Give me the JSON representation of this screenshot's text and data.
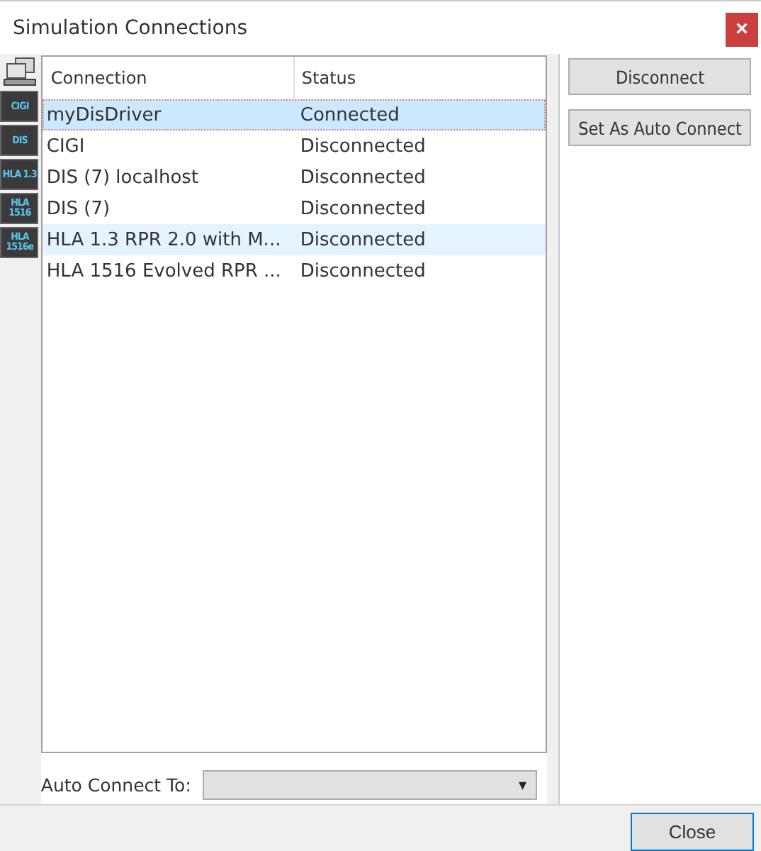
{
  "window": {
    "title": "Simulation Connections",
    "close": "×"
  },
  "toolbar": [
    {
      "kind": "network"
    },
    {
      "kind": "tile",
      "label": "CIGI"
    },
    {
      "kind": "tile",
      "label": "DIS"
    },
    {
      "kind": "tile",
      "label": "HLA 1.3"
    },
    {
      "kind": "tile",
      "label": "HLA 1516"
    },
    {
      "kind": "tile",
      "label": "HLA 1516e"
    }
  ],
  "table": {
    "columns": [
      "Connection",
      "Status"
    ],
    "rows": [
      {
        "connection": "myDisDriver",
        "status": "Connected",
        "selected": true,
        "hovered": false
      },
      {
        "connection": "CIGI",
        "status": "Disconnected",
        "selected": false,
        "hovered": false
      },
      {
        "connection": "DIS (7) localhost",
        "status": "Disconnected",
        "selected": false,
        "hovered": false
      },
      {
        "connection": "DIS (7)",
        "status": "Disconnected",
        "selected": false,
        "hovered": false
      },
      {
        "connection": "HLA 1.3 RPR 2.0 with M...",
        "status": "Disconnected",
        "selected": false,
        "hovered": true
      },
      {
        "connection": "HLA 1516 Evolved RPR ...",
        "status": "Disconnected",
        "selected": false,
        "hovered": false
      }
    ]
  },
  "buttons": [
    "Disconnect",
    "Set As Auto Connect"
  ],
  "auto_connect": {
    "label": "Auto Connect To:",
    "arrow": "▾"
  },
  "footer_button": "Close"
}
